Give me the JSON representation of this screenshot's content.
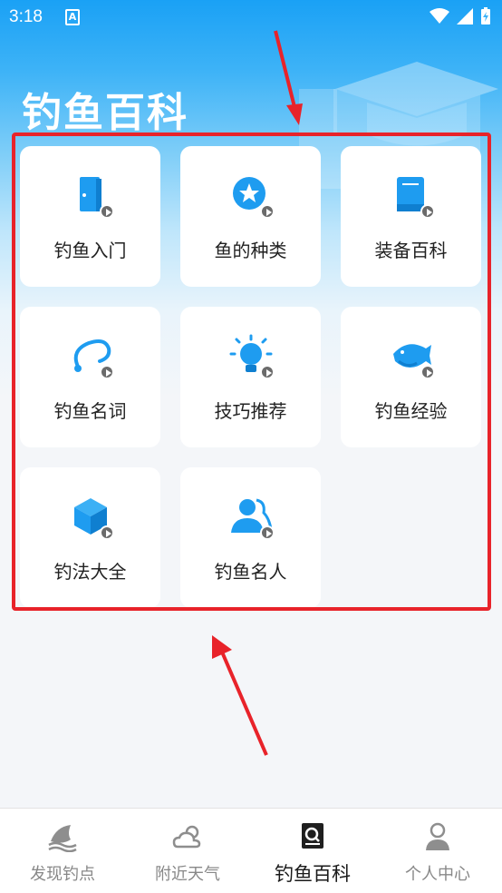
{
  "status_bar": {
    "time": "3:18",
    "a_icon_label": "A"
  },
  "page": {
    "title": "钓鱼百科"
  },
  "categories": [
    {
      "label": "钓鱼入门",
      "icon": "door-icon"
    },
    {
      "label": "鱼的种类",
      "icon": "star-badge-icon"
    },
    {
      "label": "装备百科",
      "icon": "book-icon"
    },
    {
      "label": "钓鱼名词",
      "icon": "fishing-hook-icon"
    },
    {
      "label": "技巧推荐",
      "icon": "lightbulb-icon"
    },
    {
      "label": "钓鱼经验",
      "icon": "fish-icon"
    },
    {
      "label": "钓法大全",
      "icon": "cube-icon"
    },
    {
      "label": "钓鱼名人",
      "icon": "person-icon"
    }
  ],
  "tab_bar": {
    "tabs": [
      {
        "label": "发现钓点",
        "icon": "fish-spot-icon",
        "active": false
      },
      {
        "label": "附近天气",
        "icon": "weather-icon",
        "active": false
      },
      {
        "label": "钓鱼百科",
        "icon": "encyclopedia-icon",
        "active": true
      },
      {
        "label": "个人中心",
        "icon": "profile-icon",
        "active": false
      }
    ]
  },
  "colors": {
    "accent": "#1aa1f5",
    "icon_blue": "#1e9cf0",
    "highlight_red": "#e8232a"
  }
}
